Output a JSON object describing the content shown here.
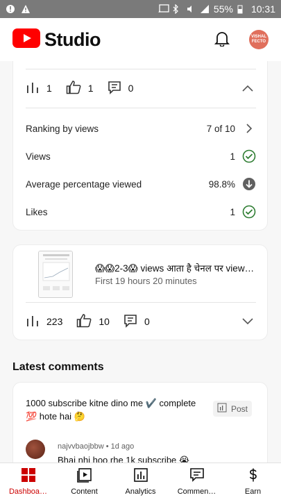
{
  "statusbar": {
    "battery": "55%",
    "time": "10:31"
  },
  "appbar": {
    "logo_text": "Studio",
    "avatar_text": "VISHAL FECTO"
  },
  "card1": {
    "stats": {
      "views": "1",
      "likes": "1",
      "comments": "0"
    },
    "rows": [
      {
        "label": "Ranking by views",
        "value": "7 of 10",
        "tail": "chevron-right-icon"
      },
      {
        "label": "Views",
        "value": "1",
        "tail": "check-circle-icon"
      },
      {
        "label": "Average percentage viewed",
        "value": "98.8%",
        "tail": "arrow-down-circle-icon"
      },
      {
        "label": "Likes",
        "value": "1",
        "tail": "check-circle-icon"
      }
    ]
  },
  "card2": {
    "title": "😱😱2-3😱  views आता है चेनल पर views …",
    "subtitle": "First 19 hours 20 minutes",
    "stats": {
      "views": "223",
      "likes": "10",
      "comments": "0"
    }
  },
  "comments": {
    "section_title": "Latest comments",
    "text": "1000 subscribe kitne dino me ✔️ complete 💯 hote hai 🤔",
    "post_label": "Post",
    "author": "najvvbaojbbw",
    "time": "1d ago",
    "body": "Bhai nhi hoo rhe 1k subscribe 😭"
  },
  "nav": [
    {
      "label": "Dashboa…",
      "icon": "dashboard-icon",
      "active": true
    },
    {
      "label": "Content",
      "icon": "content-icon",
      "active": false
    },
    {
      "label": "Analytics",
      "icon": "analytics-icon",
      "active": false
    },
    {
      "label": "Commen…",
      "icon": "comments-icon",
      "active": false
    },
    {
      "label": "Earn",
      "icon": "earn-icon",
      "active": false
    }
  ],
  "colors": {
    "brand": "#ff0000",
    "check": "#2e7d32",
    "active_nav": "#cc0000"
  }
}
